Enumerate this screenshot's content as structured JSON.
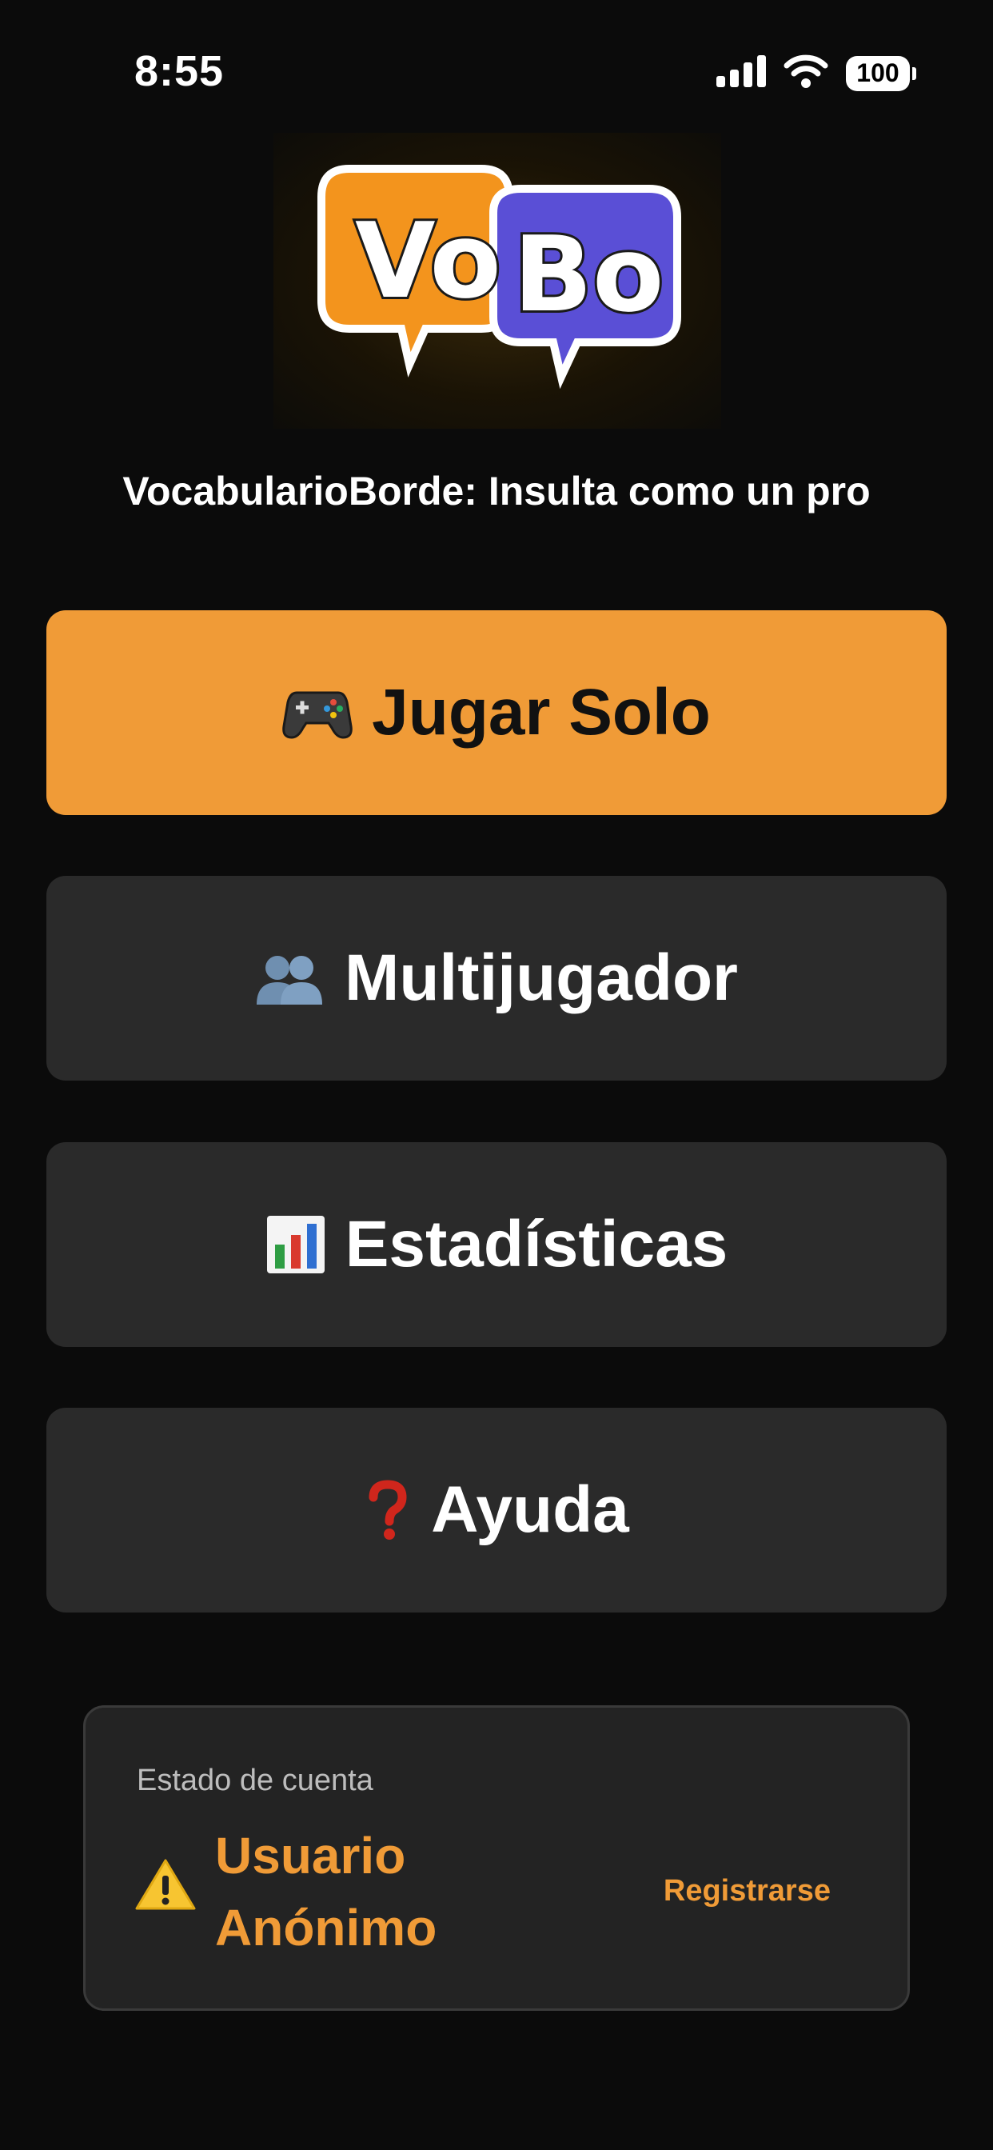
{
  "status_bar": {
    "time": "8:55",
    "battery": "100"
  },
  "logo": {
    "alt": "VoBo",
    "word1": "Vo",
    "word2": "Bo"
  },
  "subtitle": "VocabularioBorde: Insulta como un pro",
  "menu": {
    "play_solo": {
      "label": "Jugar Solo",
      "icon": "game-controller-icon"
    },
    "multiplayer": {
      "label": "Multijugador",
      "icon": "two-users-icon"
    },
    "stats": {
      "label": "Estadísticas",
      "icon": "bar-chart-icon"
    },
    "help": {
      "label": "Ayuda",
      "icon": "question-mark-icon"
    }
  },
  "account": {
    "caption": "Estado de cuenta",
    "status_line1": "Usuario",
    "status_line2": "Anónimo",
    "register_label": "Registrarse"
  },
  "colors": {
    "accent": "#f09b37",
    "background": "#0b0b0b",
    "button": "#2a2a2a"
  }
}
